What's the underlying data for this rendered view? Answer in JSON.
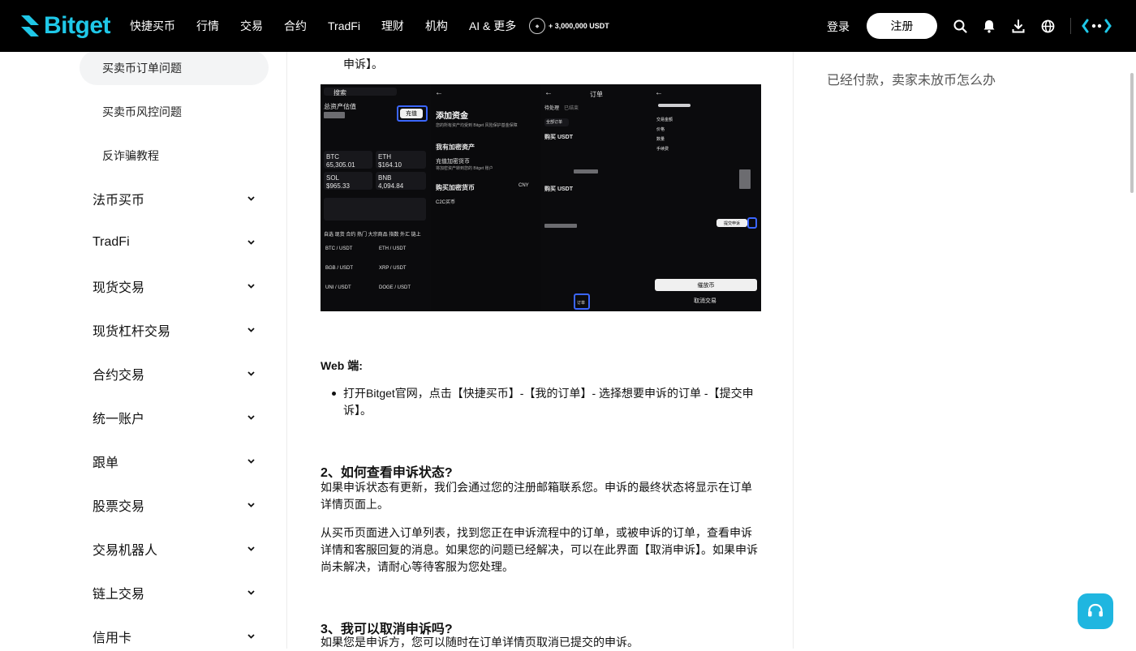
{
  "header": {
    "logo_text": "Bitget",
    "nav": [
      "快捷买币",
      "行情",
      "交易",
      "合约",
      "TradFi",
      "理财",
      "机构",
      "AI & 更多"
    ],
    "promo": "+ 3,000,000 USDT",
    "login": "登录",
    "register": "注册",
    "icons": [
      "search-icon",
      "bell-icon",
      "download-icon",
      "globe-icon",
      "bitget-ai-icon"
    ]
  },
  "sidebar": {
    "sub_items": [
      {
        "label": "买卖币订单问题",
        "active": true
      },
      {
        "label": "买卖币风控问题",
        "active": false
      },
      {
        "label": "反诈骗教程",
        "active": false
      }
    ],
    "categories": [
      "法币买币",
      "TradFi",
      "现货交易",
      "现货杠杆交易",
      "合约交易",
      "统一账户",
      "跟单",
      "股票交易",
      "交易机器人",
      "链上交易",
      "信用卡"
    ]
  },
  "article": {
    "top_fragment": "申诉】。",
    "web_label": "Web 端:",
    "web_bullet": "打开Bitget官网，点击【快捷买币】-【我的订单】- 选择想要申诉的订单 -【提交申诉】。",
    "h2_status": "2、如何查看申诉状态?",
    "p_status_1": "如果申诉状态有更新，我们会通过您的注册邮箱联系您。申诉的最终状态将显示在订单详情页面上。",
    "p_status_2": "从买币页面进入订单列表，找到您正在申诉流程中的订单，或被申诉的订单，查看申诉详情和客服回复的消息。如果您的问题已经解决，可以在此界面【取消申诉】。如果申诉尚未解决，请耐心等待客服为您处理。",
    "h2_cancel": "3、我可以取消申诉吗?",
    "p_cancel": "如果您是申诉方，您可以随时在订单详情页取消已提交的申诉。"
  },
  "screenshot": {
    "p1": {
      "search": "搜索",
      "assets": "总资产估值",
      "deposit_btn": "充值",
      "tickers": [
        {
          "pair": "BTC",
          "price": "65,305.01"
        },
        {
          "pair": "ETH",
          "price": "$164.10"
        },
        {
          "pair": "SOL",
          "price": "$965.33"
        },
        {
          "pair": "BNB",
          "price": "4,094.84"
        }
      ],
      "tabs": "自选  现货  合约  热门  大宗商品  指数  外汇  链上",
      "list": [
        {
          "left": "BTC / USDT",
          "right": "ETH / USDT"
        },
        {
          "left": "BGB / USDT",
          "right": "XRP / USDT"
        },
        {
          "left": "UNI / USDT",
          "right": "DOGE / USDT"
        }
      ]
    },
    "p2": {
      "title": "添加资金",
      "subtitle": "您的所有资产均受到 Bitget 风险保护基金保障",
      "have_crypto": "我有加密资产",
      "deposit_crypto": "充值加密货币",
      "deposit_desc": "将加密资产转到您的 Bitget 账户",
      "buy_crypto": "购买加密货币",
      "currency": "CNY",
      "c2c": "C2C买币"
    },
    "p3": {
      "title": "订单",
      "tab_pending": "待处理",
      "tab_done": "已结束",
      "filter_all": "全部订单",
      "buy1": "购买 USDT",
      "buy2": "购买 USDT",
      "nav_order": "订单"
    },
    "p4": {
      "status": "交易金额",
      "price": "价格",
      "amount": "数量",
      "fee": "手续费",
      "buy_btn": "催放币",
      "cancel_btn": "取消交易",
      "appeal_btn": "提交申诉"
    }
  },
  "right": {
    "related_title": "已经付款，卖家未放币怎么办"
  },
  "colors": {
    "brand": "#1fc8e8",
    "support_button": "#1fb6e0",
    "highlight_box": "#3b66ff"
  }
}
